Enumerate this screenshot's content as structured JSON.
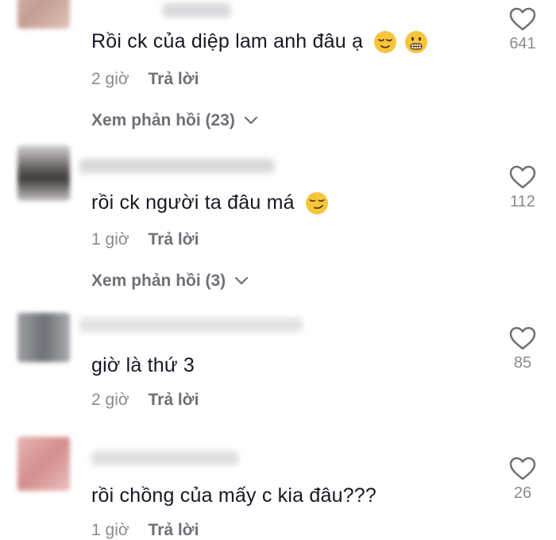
{
  "comments": [
    {
      "text": "Rồi ck của diệp lam anh đâu ạ",
      "emojis": [
        "relieved-face",
        "grimacing-face"
      ],
      "time": "2 giờ",
      "reply_label": "Trả lời",
      "view_replies": "Xem phản hồi (23)",
      "likes": "641",
      "avatar_color": "#c9a89f"
    },
    {
      "text": "rồi ck người ta đâu má",
      "emojis": [
        "smirking-face"
      ],
      "time": "1 giờ",
      "reply_label": "Trả lời",
      "view_replies": "Xem phản hồi (3)",
      "likes": "112",
      "avatar_color": "#6d6a68"
    },
    {
      "text": "giờ là thứ 3",
      "emojis": [],
      "time": "2 giờ",
      "reply_label": "Trả lời",
      "view_replies": "",
      "likes": "85",
      "avatar_color": "#7c7f86"
    },
    {
      "text": "rồi chồng của mấy c kia đâu???",
      "emojis": [],
      "time": "1 giờ",
      "reply_label": "Trả lời",
      "view_replies": "",
      "likes": "26",
      "avatar_color": "#d89a9a"
    }
  ],
  "colors": {
    "text_primary": "#161823",
    "text_secondary": "#8a8b91",
    "emoji_yellow": "#f6c53a"
  }
}
